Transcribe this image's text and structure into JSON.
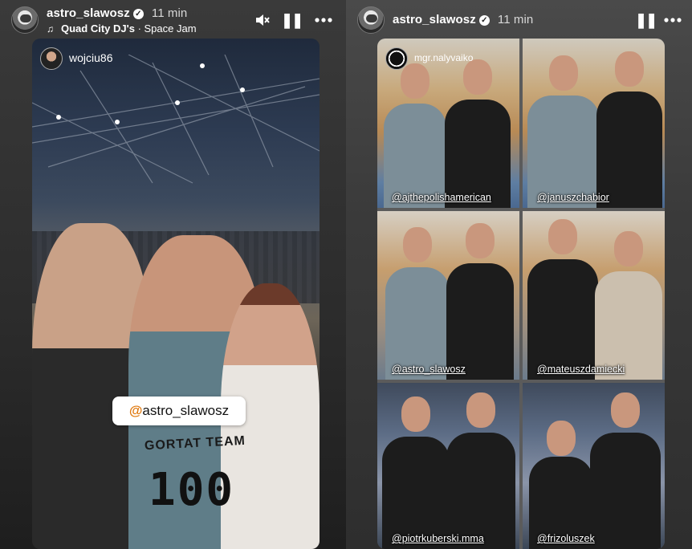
{
  "stories": [
    {
      "header": {
        "username": "astro_slawosz",
        "time": "11 min",
        "music_artist": "Quad City DJ's",
        "music_separator": " · ",
        "music_track": "Space Jam"
      },
      "story_user": "wojciu86",
      "mention_sticker": "astro_slawosz",
      "jersey_team": "GORTAT TEAM",
      "jersey_number": "100"
    },
    {
      "header": {
        "username": "astro_slawosz",
        "time": "11 min"
      },
      "story_user": "mgr.nalyvaiko",
      "tags": [
        "@ajthepolishamerican",
        "@januszchabior",
        "@astro_slawosz",
        "@mateuszdamiecki",
        "@piotrkuberski.mma",
        "@frizoluszek"
      ]
    }
  ],
  "icons": {
    "verified": "verified-badge-icon",
    "music": "music-note-icon",
    "mute": "muted-speaker-icon",
    "pause": "pause-icon",
    "more": "more-horizontal-icon"
  },
  "colors": {
    "mention_at": "#e07a10",
    "text": "#ffffff"
  }
}
